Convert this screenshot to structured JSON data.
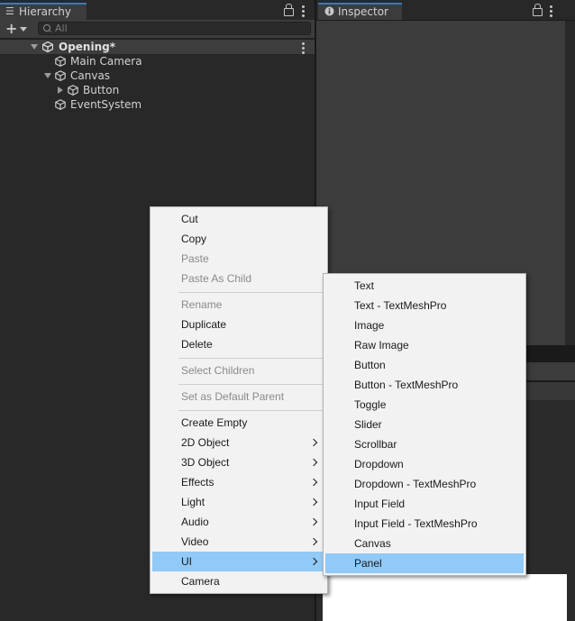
{
  "hierarchy": {
    "tab_label": "Hierarchy",
    "search_placeholder": "All",
    "scene_name": "Opening*",
    "items": [
      {
        "label": "Main Camera"
      },
      {
        "label": "Canvas"
      },
      {
        "label": "Button"
      },
      {
        "label": "EventSystem"
      }
    ]
  },
  "inspector": {
    "tab_label": "Inspector"
  },
  "context_menu": {
    "items": [
      {
        "label": "Cut",
        "enabled": true
      },
      {
        "label": "Copy",
        "enabled": true
      },
      {
        "label": "Paste",
        "enabled": false
      },
      {
        "label": "Paste As Child",
        "enabled": false
      },
      {
        "label": "Rename",
        "enabled": false
      },
      {
        "label": "Duplicate",
        "enabled": true
      },
      {
        "label": "Delete",
        "enabled": true
      },
      {
        "label": "Select Children",
        "enabled": false
      },
      {
        "label": "Set as Default Parent",
        "enabled": false
      },
      {
        "label": "Create Empty",
        "enabled": true
      },
      {
        "label": "2D Object",
        "enabled": true,
        "submenu": true
      },
      {
        "label": "3D Object",
        "enabled": true,
        "submenu": true
      },
      {
        "label": "Effects",
        "enabled": true,
        "submenu": true
      },
      {
        "label": "Light",
        "enabled": true,
        "submenu": true
      },
      {
        "label": "Audio",
        "enabled": true,
        "submenu": true
      },
      {
        "label": "Video",
        "enabled": true,
        "submenu": true
      },
      {
        "label": "UI",
        "enabled": true,
        "submenu": true,
        "highlighted": true
      },
      {
        "label": "Camera",
        "enabled": true
      }
    ]
  },
  "ui_submenu": {
    "items": [
      {
        "label": "Text"
      },
      {
        "label": "Text - TextMeshPro"
      },
      {
        "label": "Image"
      },
      {
        "label": "Raw Image"
      },
      {
        "label": "Button"
      },
      {
        "label": "Button - TextMeshPro"
      },
      {
        "label": "Toggle"
      },
      {
        "label": "Slider"
      },
      {
        "label": "Scrollbar"
      },
      {
        "label": "Dropdown"
      },
      {
        "label": "Dropdown - TextMeshPro"
      },
      {
        "label": "Input Field"
      },
      {
        "label": "Input Field - TextMeshPro"
      },
      {
        "label": "Canvas"
      },
      {
        "label": "Panel",
        "highlighted": true
      }
    ]
  },
  "colors": {
    "menu_highlight": "#91c9f7",
    "tab_accent": "#3a79bb",
    "editor_dark": "#282828"
  }
}
